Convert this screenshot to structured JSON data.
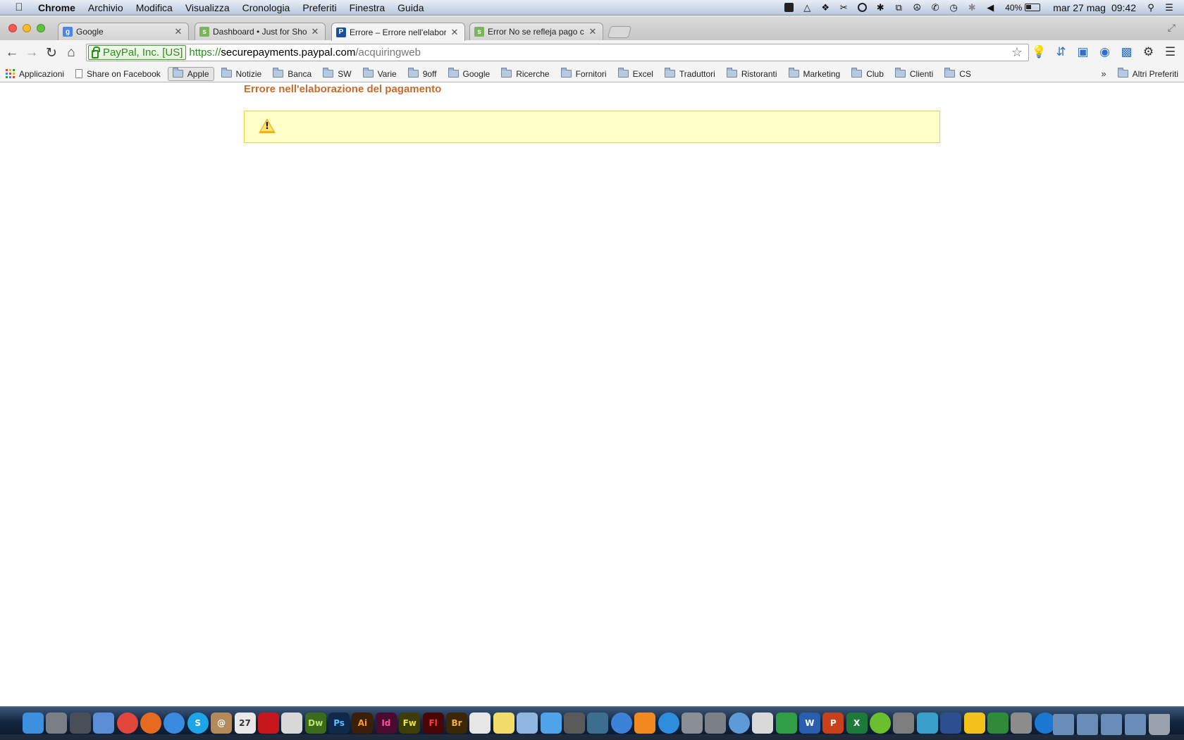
{
  "menubar": {
    "app": "Chrome",
    "items": [
      "Archivio",
      "Modifica",
      "Visualizza",
      "Cronologia",
      "Preferiti",
      "Finestra",
      "Guida"
    ],
    "battery": "40%",
    "date": "mar 27 mag",
    "time": "09:42"
  },
  "tabs": [
    {
      "title": "Google",
      "favicon": "google-icon",
      "color": "#4a86e8",
      "active": false
    },
    {
      "title": "Dashboard • Just for Shop",
      "favicon": "shopify-icon",
      "color": "#7ab55c",
      "active": false
    },
    {
      "title": "Errore – Errore nell'elabora",
      "favicon": "paypal-icon",
      "color": "#1a4f9c",
      "active": true
    },
    {
      "title": "Error No se refleja pago co",
      "favicon": "shopify-icon",
      "color": "#7ab55c",
      "active": false
    }
  ],
  "toolbar": {
    "ev_label": "PayPal, Inc. [US]",
    "url_scheme": "https://",
    "url_host": "securepayments.paypal.com",
    "url_path": "/acquiringweb"
  },
  "bookmarks": {
    "apps": "Applicazioni",
    "share": "Share on Facebook",
    "folders": [
      "Apple",
      "Notizie",
      "Banca",
      "SW",
      "Varie",
      "9off",
      "Google",
      "Ricerche",
      "Fornitori",
      "Excel",
      "Traduttori",
      "Ristoranti",
      "Marketing",
      "Club",
      "Clienti",
      "CS"
    ],
    "overflow": "»",
    "other": "Altri Preferiti"
  },
  "page": {
    "title": "Errore nell'elaborazione del pagamento"
  },
  "dock": {
    "icons": [
      {
        "name": "finder-icon",
        "label": "",
        "color": "#3d8fe0"
      },
      {
        "name": "launchpad-icon",
        "label": "",
        "color": "#7a7f86"
      },
      {
        "name": "mission-control-icon",
        "label": "",
        "color": "#4a4f57"
      },
      {
        "name": "mail-icon",
        "label": "",
        "color": "#5b8ed6"
      },
      {
        "name": "chrome-icon",
        "label": "",
        "color": "#e2453c"
      },
      {
        "name": "firefox-icon",
        "label": "",
        "color": "#e66a1f"
      },
      {
        "name": "safari-icon",
        "label": "",
        "color": "#3a8be0"
      },
      {
        "name": "skype-icon",
        "label": "S",
        "color": "#1ea5e8"
      },
      {
        "name": "contacts-icon",
        "label": "@",
        "color": "#b48a5a"
      },
      {
        "name": "calendar-icon",
        "label": "27",
        "color": "#e8e8e8"
      },
      {
        "name": "acrobat-icon",
        "label": "",
        "color": "#c8161d"
      },
      {
        "name": "acrobat-reader-icon",
        "label": "",
        "color": "#d8d8d8"
      },
      {
        "name": "dreamweaver-icon",
        "label": "Dw",
        "color": "#3d6b1e"
      },
      {
        "name": "photoshop-icon",
        "label": "Ps",
        "color": "#10294a"
      },
      {
        "name": "illustrator-icon",
        "label": "Ai",
        "color": "#3b1f06"
      },
      {
        "name": "indesign-icon",
        "label": "Id",
        "color": "#4a0b2e"
      },
      {
        "name": "fireworks-icon",
        "label": "Fw",
        "color": "#3e3d06"
      },
      {
        "name": "flash-icon",
        "label": "Fl",
        "color": "#4a0606"
      },
      {
        "name": "bridge-icon",
        "label": "Br",
        "color": "#3b2606"
      },
      {
        "name": "textedit-icon",
        "label": "",
        "color": "#e6e6e6"
      },
      {
        "name": "notes-icon",
        "label": "",
        "color": "#f2dc6a"
      },
      {
        "name": "preview-icon",
        "label": "",
        "color": "#8fb8e0"
      },
      {
        "name": "messages-icon",
        "label": "",
        "color": "#4fa3e8"
      },
      {
        "name": "facetime-icon",
        "label": "",
        "color": "#5a5a5a"
      },
      {
        "name": "iphoto-icon",
        "label": "",
        "color": "#3c6e8f"
      },
      {
        "name": "itunes-icon",
        "label": "",
        "color": "#3c82d8"
      },
      {
        "name": "ibooks-icon",
        "label": "",
        "color": "#f08a1e"
      },
      {
        "name": "app-store-icon",
        "label": "",
        "color": "#2f8de0"
      },
      {
        "name": "system-preferences-icon",
        "label": "",
        "color": "#8a8f96"
      },
      {
        "name": "utility-icon",
        "label": "",
        "color": "#7b7f86"
      },
      {
        "name": "airport-icon",
        "label": "",
        "color": "#5c9ad8"
      },
      {
        "name": "script-editor-icon",
        "label": "",
        "color": "#d9d9d9"
      },
      {
        "name": "google-drive-icon",
        "label": "",
        "color": "#2f9e44"
      },
      {
        "name": "word-icon",
        "label": "W",
        "color": "#2a5fb0"
      },
      {
        "name": "powerpoint-icon",
        "label": "P",
        "color": "#c8411b"
      },
      {
        "name": "excel-icon",
        "label": "X",
        "color": "#1e7a38"
      },
      {
        "name": "spotify-icon",
        "label": "",
        "color": "#6bbf2e"
      },
      {
        "name": "evernote-elephant-icon",
        "label": "",
        "color": "#7d7d7d"
      },
      {
        "name": "mamp-icon",
        "label": "",
        "color": "#3aa0c9"
      },
      {
        "name": "virtualbox-icon",
        "label": "",
        "color": "#2b4f8f"
      },
      {
        "name": "cyberduck-icon",
        "label": "",
        "color": "#f2c21a"
      },
      {
        "name": "excel-mac-icon",
        "label": "",
        "color": "#2f8a3a"
      },
      {
        "name": "tools-icon",
        "label": "",
        "color": "#8c8c8c"
      },
      {
        "name": "teamviewer-icon",
        "label": "",
        "color": "#1a77d2"
      }
    ]
  }
}
